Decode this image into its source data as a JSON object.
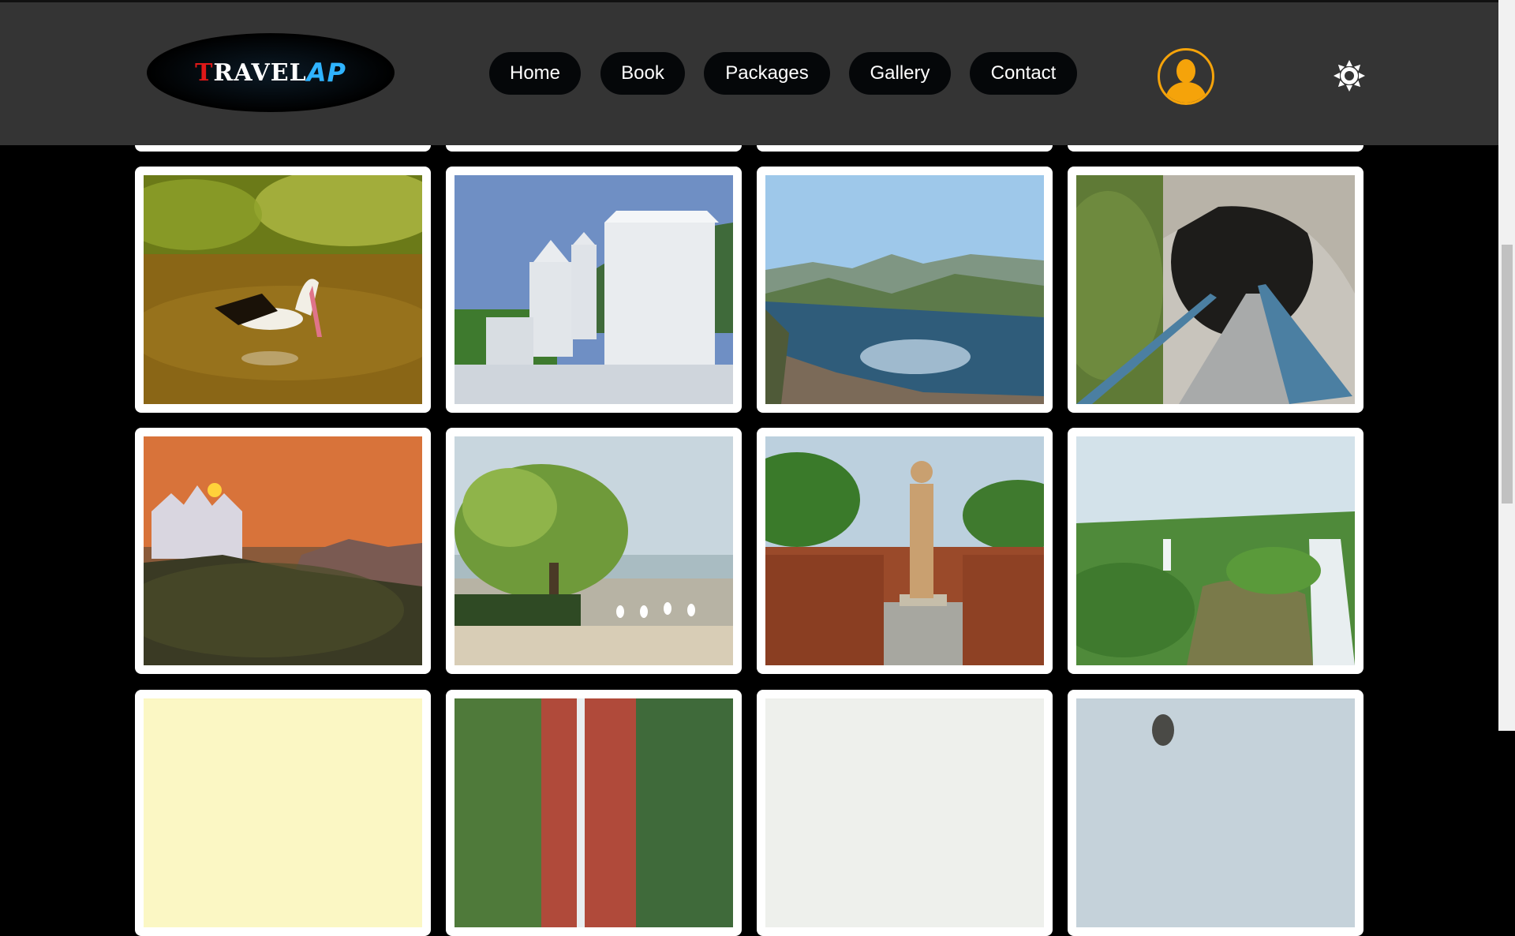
{
  "brand": {
    "logo_part1": "T",
    "logo_part2": "RAVEL",
    "logo_part3": "AP"
  },
  "nav": {
    "home": "Home",
    "book": "Book",
    "packages": "Packages",
    "gallery": "Gallery",
    "contact": "Contact"
  },
  "icons": {
    "avatar": "user-avatar-icon",
    "theme_toggle": "sun-icon"
  },
  "colors": {
    "header_bg": "#343434",
    "page_bg": "#000000",
    "avatar_ring": "#f5a30a",
    "nav_button_bg": "#050709"
  },
  "gallery": {
    "images": [
      "pelican-in-lake",
      "white-temple-towers",
      "lake-and-hills",
      "cave-walkway",
      "sunset-temple-on-hill",
      "tree-and-egrets-at-shore",
      "buddha-statue-ruins",
      "waterfall-gorge",
      "partial-yellow-image",
      "partial-waterfall-cliff",
      "partial-hazy-image",
      "partial-dome-structure"
    ]
  }
}
